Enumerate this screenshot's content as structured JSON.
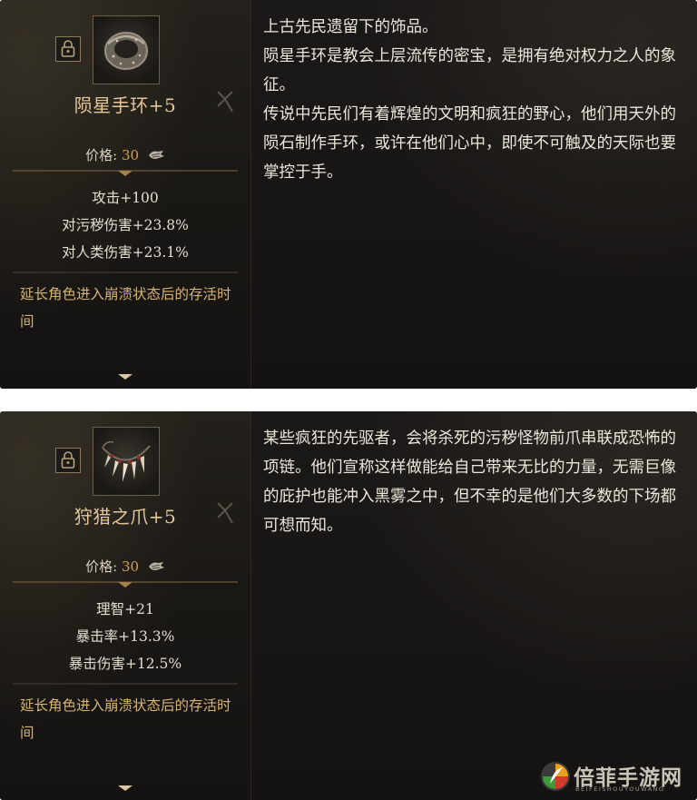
{
  "items": [
    {
      "name": "陨星手环+5",
      "price_label": "价格:",
      "price_value": "30",
      "stats": [
        "攻击+100",
        "对污秽伤害+23.8%",
        "对人类伤害+23.1%"
      ],
      "effect": "延长角色进入崩溃状态后的存活时间",
      "description": [
        "上古先民遗留下的饰品。",
        "陨星手环是教会上层流传的密宝，是拥有绝对权力之人的象征。",
        "传说中先民们有着辉煌的文明和疯狂的野心，他们用天外的陨石制作手环，或许在他们心中，即使不可触及的天际也要掌控于手。"
      ],
      "icon": "meteor-bracelet-icon"
    },
    {
      "name": "狩猎之爪+5",
      "price_label": "价格:",
      "price_value": "30",
      "stats": [
        "理智+21",
        "暴击率+13.3%",
        "暴击伤害+12.5%"
      ],
      "effect": "延长角色进入崩溃状态后的存活时间",
      "description": [
        "某些疯狂的先驱者，会将杀死的污秽怪物前爪串联成恐怖的项链。他们宣称这样做能给自己带来无比的力量，无需巨像的庇护也能冲入黑雾之中，但不幸的是他们大多数的下场都可想而知。"
      ],
      "icon": "claw-necklace-icon"
    }
  ],
  "watermark": {
    "text": "倍菲手游网",
    "sub": "BEIFEISHOUYOUWANG"
  },
  "colors": {
    "item_name": "#e2c79a",
    "price_value": "#d9a04a",
    "effect_text": "#d7b474",
    "description_text": "#ece6dc",
    "panel_bg": "#141210"
  }
}
